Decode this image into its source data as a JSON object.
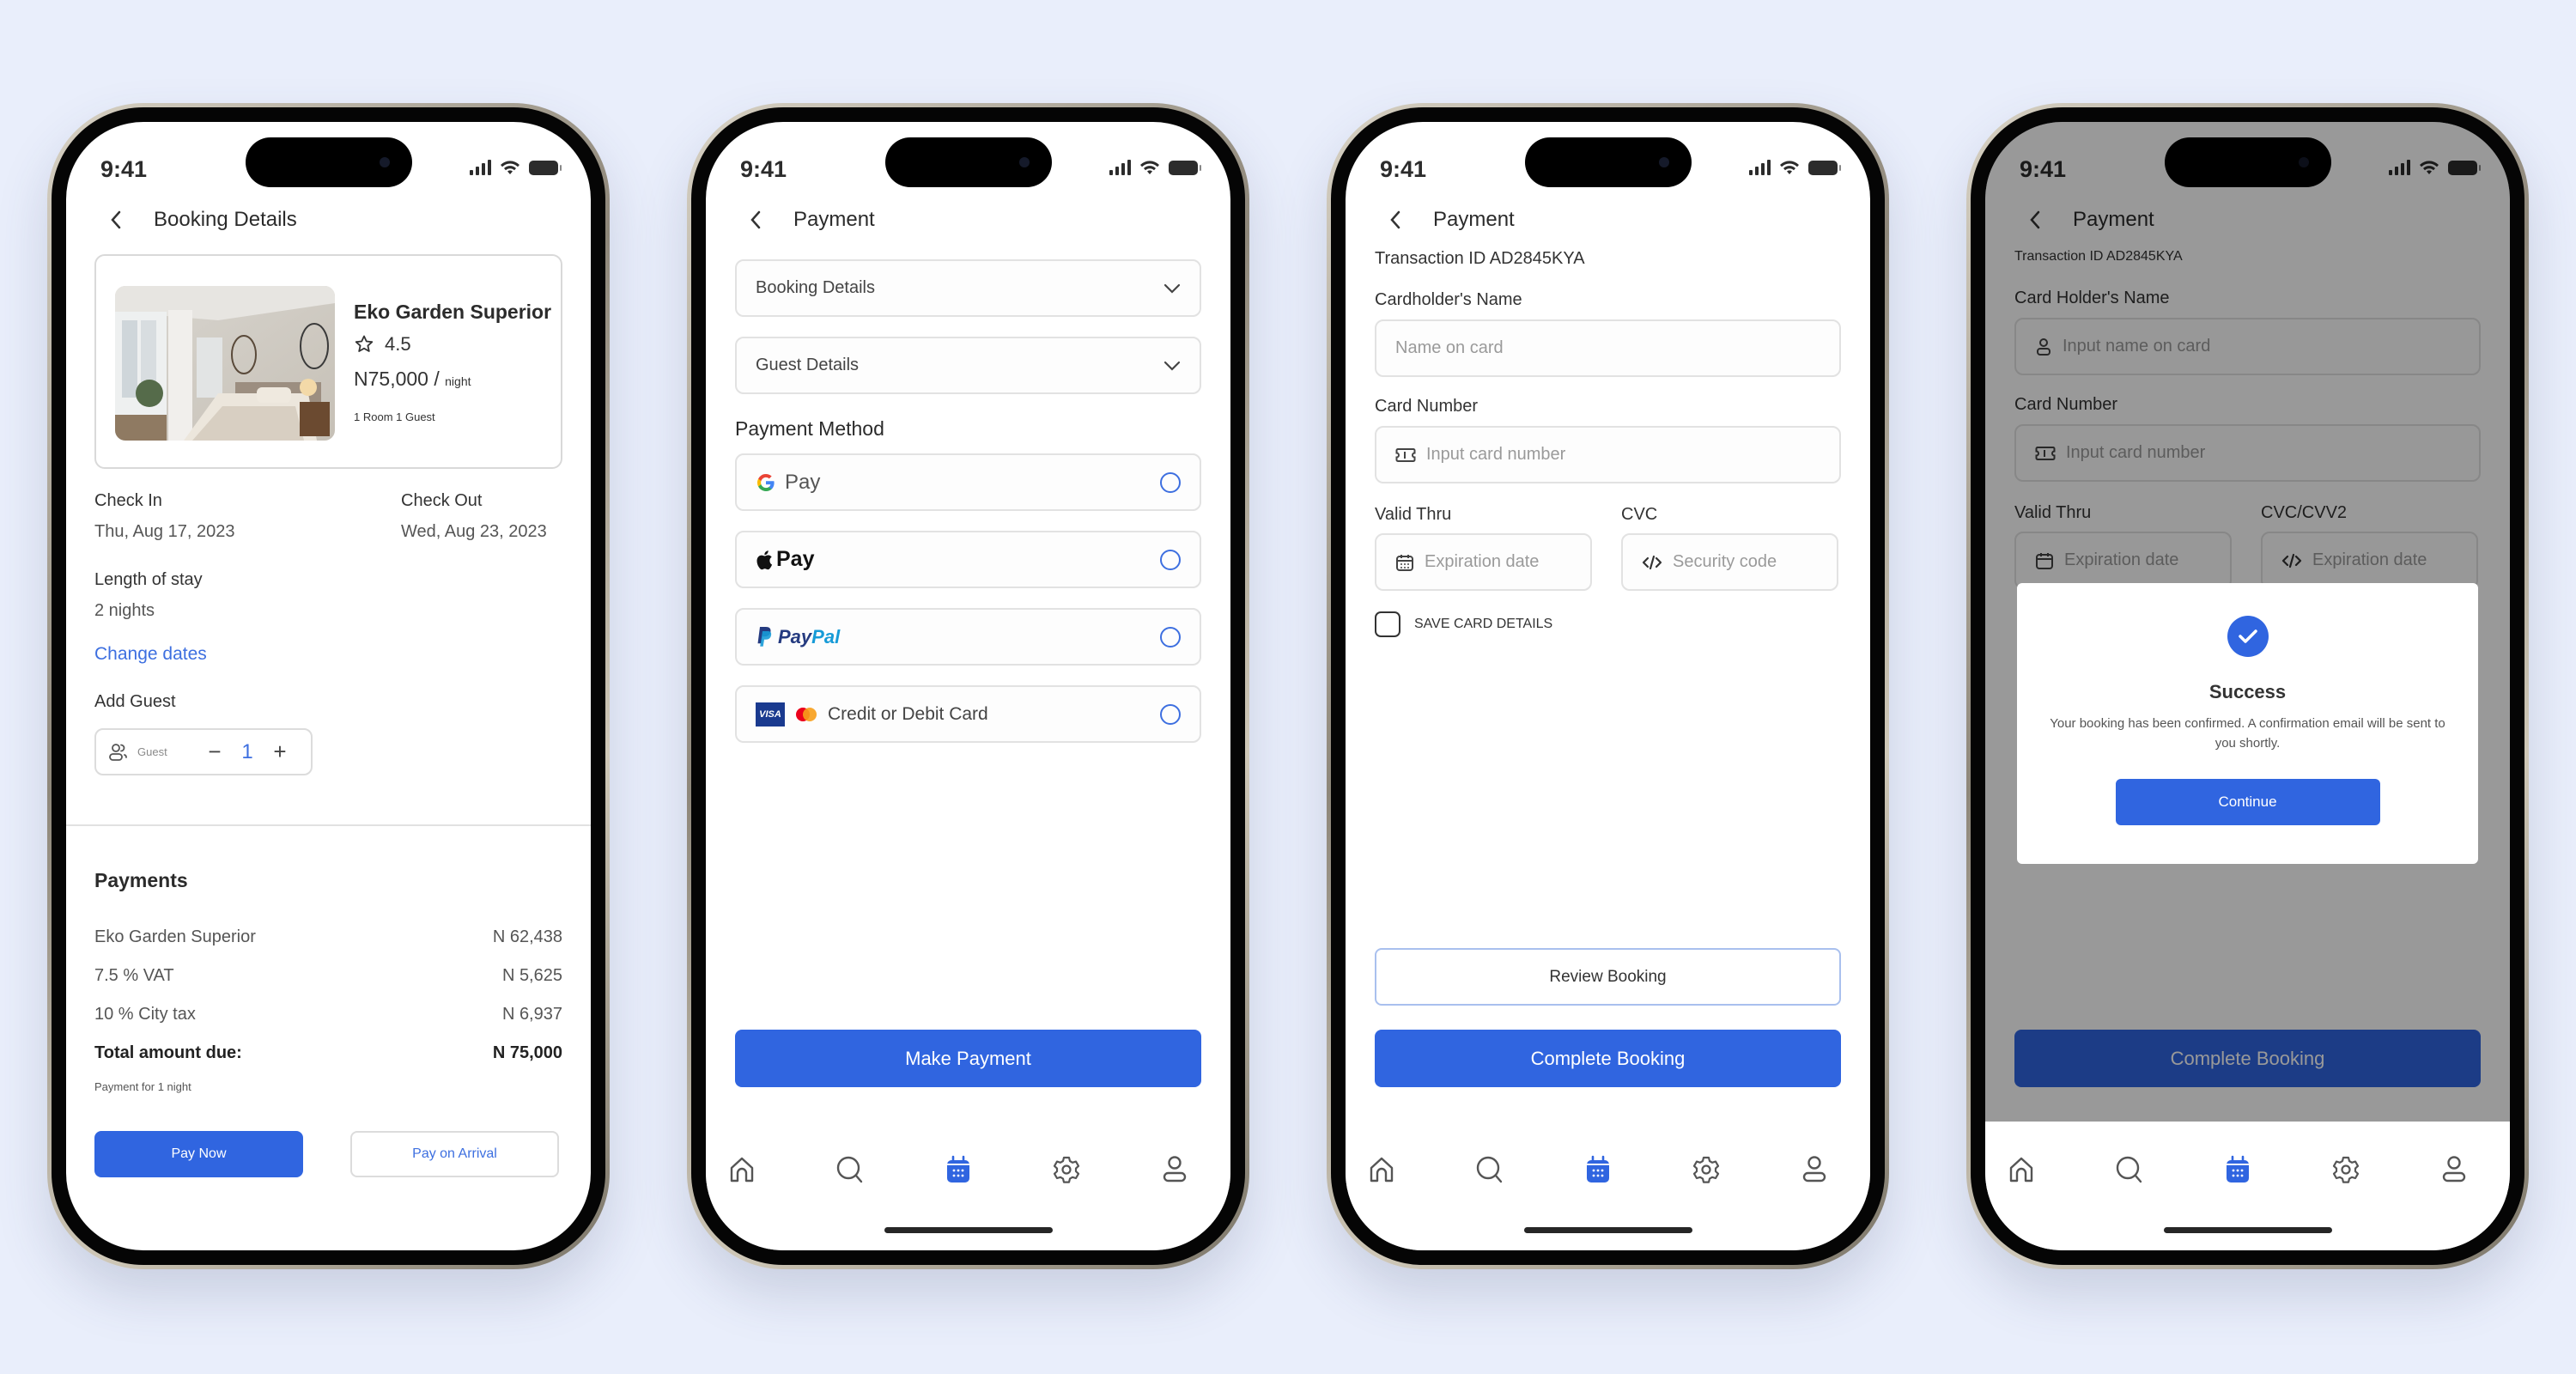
{
  "colors": {
    "accent": "#3065e0",
    "background": "#e9eefb",
    "link": "#3d6fe0"
  },
  "status_bar": {
    "time": "9:41"
  },
  "screens": {
    "booking_details": {
      "title": "Booking Details",
      "room": {
        "name": "Eko Garden Superior",
        "rating": "4.5",
        "price": "N75,000 /",
        "price_unit": "night",
        "guests": "1 Room 1 Guest"
      },
      "check_in_label": "Check In",
      "check_in_value": "Thu, Aug 17, 2023",
      "check_out_label": "Check Out",
      "check_out_value": "Wed, Aug 23, 2023",
      "length_label": "Length of stay",
      "length_value": "2 nights",
      "change_dates": "Change dates",
      "add_guest_label": "Add Guest",
      "guest_stepper": {
        "label": "Guest",
        "value": "1",
        "minus": "−",
        "plus": "+"
      },
      "payments_title": "Payments",
      "payment_rows": [
        {
          "label": "Eko Garden Superior",
          "amount": "N 62,438"
        },
        {
          "label": "7.5 % VAT",
          "amount": "N 5,625"
        },
        {
          "label": "10 % City tax",
          "amount": "N 6,937"
        }
      ],
      "total_label": "Total amount due:",
      "total_amount": "N 75,000",
      "payment_note": "Payment for 1 night",
      "pay_now": "Pay Now",
      "pay_on_arrival": "Pay on Arrival"
    },
    "payment_method": {
      "title": "Payment",
      "accordions": [
        "Booking Details",
        "Guest Details"
      ],
      "section_title": "Payment Method",
      "options": [
        {
          "id": "gpay",
          "label": "Pay",
          "selected": false
        },
        {
          "id": "applepay",
          "label": "Pay",
          "selected": false
        },
        {
          "id": "paypal",
          "label": "PayPal",
          "selected": false
        },
        {
          "id": "card",
          "label": "Credit or Debit Card",
          "selected": false
        }
      ],
      "submit": "Make Payment"
    },
    "card_form": {
      "title": "Payment",
      "transaction": "Transaction ID AD2845KYA",
      "name_label": "Cardholder's Name",
      "name_placeholder": "Name on card",
      "number_label": "Card Number",
      "number_placeholder": "Input card number",
      "valid_label": "Valid Thru",
      "valid_placeholder": "Expiration date",
      "cvc_label": "CVC",
      "cvc_placeholder": "Security code",
      "save_card": "SAVE CARD DETAILS",
      "review": "Review Booking",
      "complete": "Complete Booking"
    },
    "success": {
      "title": "Payment",
      "transaction": "Transaction ID AD2845KYA",
      "name_label": "Card Holder's Name",
      "name_placeholder": "Input name on card",
      "number_label": "Card Number",
      "number_placeholder": "Input card number",
      "valid_label": "Valid Thru",
      "valid_placeholder": "Expiration date",
      "cvc_label": "CVC/CVV2",
      "cvc_placeholder": "Expiration date",
      "complete": "Complete Booking",
      "modal": {
        "title": "Success",
        "message": "Your booking has been confirmed. A confirmation email will be sent to you shortly.",
        "button": "Continue"
      }
    }
  },
  "bottom_nav": {
    "items": [
      {
        "name": "home",
        "icon": "home-icon",
        "active": false
      },
      {
        "name": "search",
        "icon": "search-icon",
        "active": false
      },
      {
        "name": "bookings",
        "icon": "calendar-icon",
        "active": true
      },
      {
        "name": "settings",
        "icon": "gear-icon",
        "active": false
      },
      {
        "name": "profile",
        "icon": "user-icon",
        "active": false
      }
    ]
  }
}
